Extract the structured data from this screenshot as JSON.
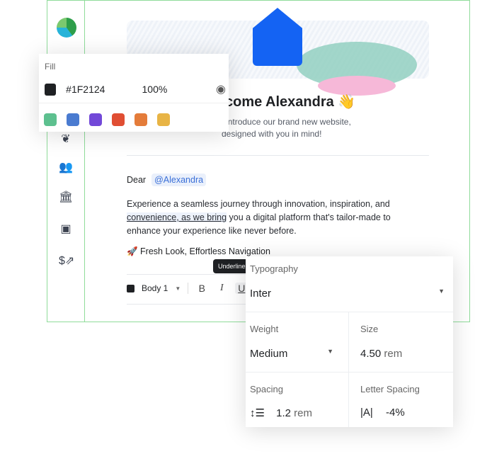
{
  "sidebar": {
    "icons": [
      "logo",
      "lotus-icon",
      "users-icon",
      "bank-icon",
      "storefront-icon",
      "invoice-icon"
    ]
  },
  "email": {
    "title": "Welcome Alexandra 👋",
    "subtitle_line1": "ed to introduce our brand new website,",
    "subtitle_line2": "designed with you in mind!",
    "greeting": "Dear",
    "mention": "@Alexandra",
    "para_highlight": "convenience, as we bring",
    "para_start": "Experience a seamless journey through innovation, inspiration, and",
    "para_end": "you a digital platform that's tailor-made to enhance your experience like never before.",
    "feature": "🚀 Fresh Look, Effortless Navigation"
  },
  "toolbar": {
    "style_label": "Body 1",
    "bold": "B",
    "italic": "I",
    "underline": "U",
    "tooltip": "Underline"
  },
  "fill": {
    "label": "Fill",
    "hex": "#1F2124",
    "opacity": "100%",
    "swatches": [
      "#5DC08F",
      "#4A7BD0",
      "#7248D8",
      "#E04E33",
      "#E47C3A",
      "#E8B445"
    ]
  },
  "typography": {
    "label": "Typography",
    "font": "Inter",
    "weight_label": "Weight",
    "weight": "Medium",
    "size_label": "Size",
    "size": "4.50",
    "size_unit": "rem",
    "spacing_label": "Spacing",
    "spacing": "1.2",
    "spacing_unit": "rem",
    "letter_label": "Letter Spacing",
    "letter": "-4%"
  }
}
